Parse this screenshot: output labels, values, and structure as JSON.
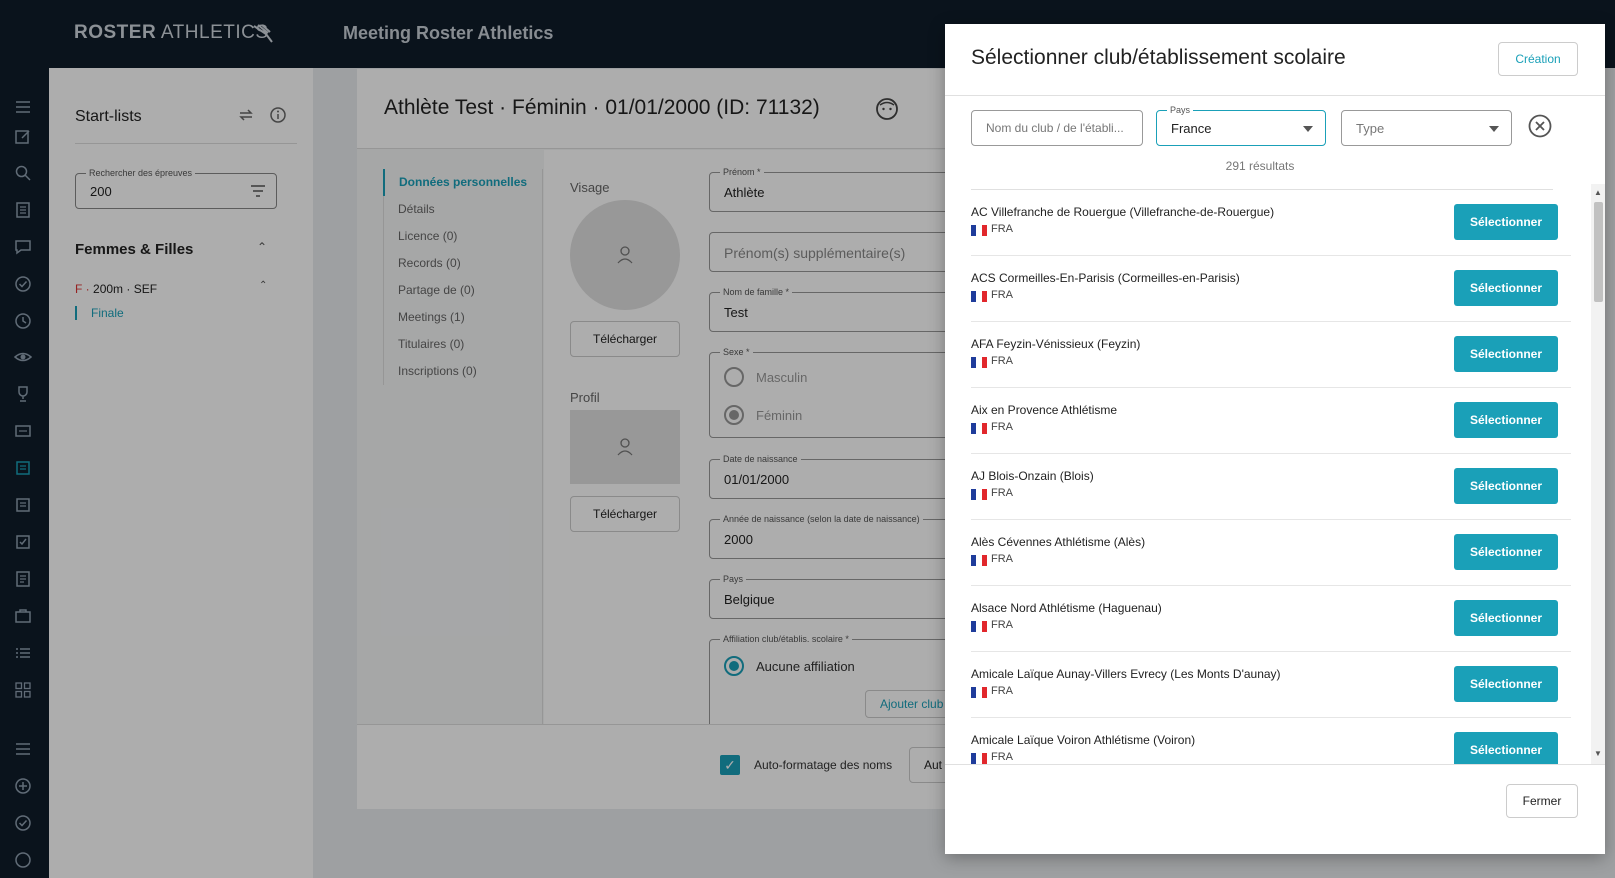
{
  "header": {
    "logo_bold": "ROSTER",
    "logo_light": "ATHLETICS",
    "app_title": "Meeting Roster Athletics"
  },
  "startlists": {
    "title": "Start-lists",
    "search_label": "Rechercher des épreuves",
    "search_value": "200",
    "group": "Femmes & Filles",
    "event_prefix": "F",
    "event_sep": " · ",
    "event_name": "200m · SEF",
    "round": "Finale"
  },
  "athlete": {
    "title": "Athlète Test · Féminin · 01/01/2000 (ID: 71132)",
    "nav": [
      "Données personnelles",
      "Détails",
      "Licence (0)",
      "Records (0)",
      "Partage de (0)",
      "Meetings (1)",
      "Titulaires (0)",
      "Inscriptions (0)"
    ],
    "visage_label": "Visage",
    "profil_label": "Profil",
    "upload_label": "Télécharger",
    "firstname_label": "Prénom *",
    "firstname_value": "Athlète",
    "extra_names_placeholder": "Prénom(s) supplémentaire(s)",
    "lastname_label": "Nom de famille *",
    "lastname_value": "Test",
    "sex_label": "Sexe *",
    "sex_male": "Masculin",
    "sex_female": "Féminin",
    "dob_label": "Date de naissance",
    "dob_value": "01/01/2000",
    "birth_year_label": "Année de naissance (selon la date de naissance)",
    "birth_year_value": "2000",
    "country_label": "Pays",
    "country_value": "Belgique",
    "affiliation_label": "Affiliation club/établis. scolaire *",
    "no_affiliation": "Aucune affiliation",
    "add_club": "Ajouter club",
    "autoformat_label": "Auto-formatage des noms",
    "auto_btn": "Aut"
  },
  "dialog": {
    "title": "Sélectionner club/établissement scolaire",
    "create_label": "Création",
    "name_placeholder": "Nom du club / de l'établi...",
    "country_label": "Pays",
    "country_value": "France",
    "type_placeholder": "Type",
    "results": "291 résultats",
    "select_label": "Sélectionner",
    "close_label": "Fermer",
    "flag_colors": [
      "#1f3c9b",
      "#ffffff",
      "#e1272c"
    ],
    "clubs": [
      {
        "name": "AC Villefranche de Rouergue (Villefranche-de-Rouergue)",
        "country": "FRA"
      },
      {
        "name": "ACS Cormeilles-En-Parisis (Cormeilles-en-Parisis)",
        "country": "FRA"
      },
      {
        "name": "AFA Feyzin-Vénissieux (Feyzin)",
        "country": "FRA"
      },
      {
        "name": "Aix en Provence Athlétisme",
        "country": "FRA"
      },
      {
        "name": "AJ Blois-Onzain (Blois)",
        "country": "FRA"
      },
      {
        "name": "Alès Cévennes Athlétisme (Alès)",
        "country": "FRA"
      },
      {
        "name": "Alsace Nord Athlétisme (Haguenau)",
        "country": "FRA"
      },
      {
        "name": "Amicale Laïque Aunay-Villers Evrecy (Les Monts D'aunay)",
        "country": "FRA"
      },
      {
        "name": "Amicale Laïque Voiron Athlétisme (Voiron)",
        "country": "FRA"
      }
    ]
  },
  "colors": {
    "accent": "#1aa0b8",
    "sidebar_bg": "#0f1c2a"
  }
}
